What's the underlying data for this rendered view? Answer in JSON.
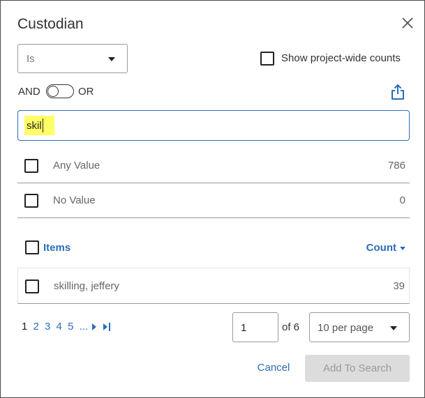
{
  "dialog": {
    "title": "Custodian",
    "close_icon": "close-icon"
  },
  "operator_select": {
    "value": "Is"
  },
  "show_project_wide": {
    "label": "Show project-wide counts",
    "checked": false
  },
  "logic_toggle": {
    "and_label": "AND",
    "or_label": "OR",
    "value": "AND"
  },
  "export_icon": "export-icon",
  "search": {
    "value": "skil"
  },
  "special_rows": [
    {
      "label": "Any Value",
      "count": "786",
      "checked": false
    },
    {
      "label": "No Value",
      "count": "0",
      "checked": false
    }
  ],
  "items_header": {
    "label": "Items",
    "sort_label": "Count"
  },
  "items": [
    {
      "label": "skilling, jeffery",
      "count": "39",
      "checked": false
    }
  ],
  "pagination": {
    "current": "1",
    "pages": [
      "2",
      "3",
      "4",
      "5"
    ],
    "ellipsis": "...",
    "page_input": "1",
    "of_label": "of 6",
    "per_page": "10 per page"
  },
  "footer": {
    "cancel_label": "Cancel",
    "add_label": "Add To Search"
  },
  "colors": {
    "link": "#2a6ebb",
    "highlight": "#ffff66",
    "disabled_bg": "#dcdcdc"
  }
}
